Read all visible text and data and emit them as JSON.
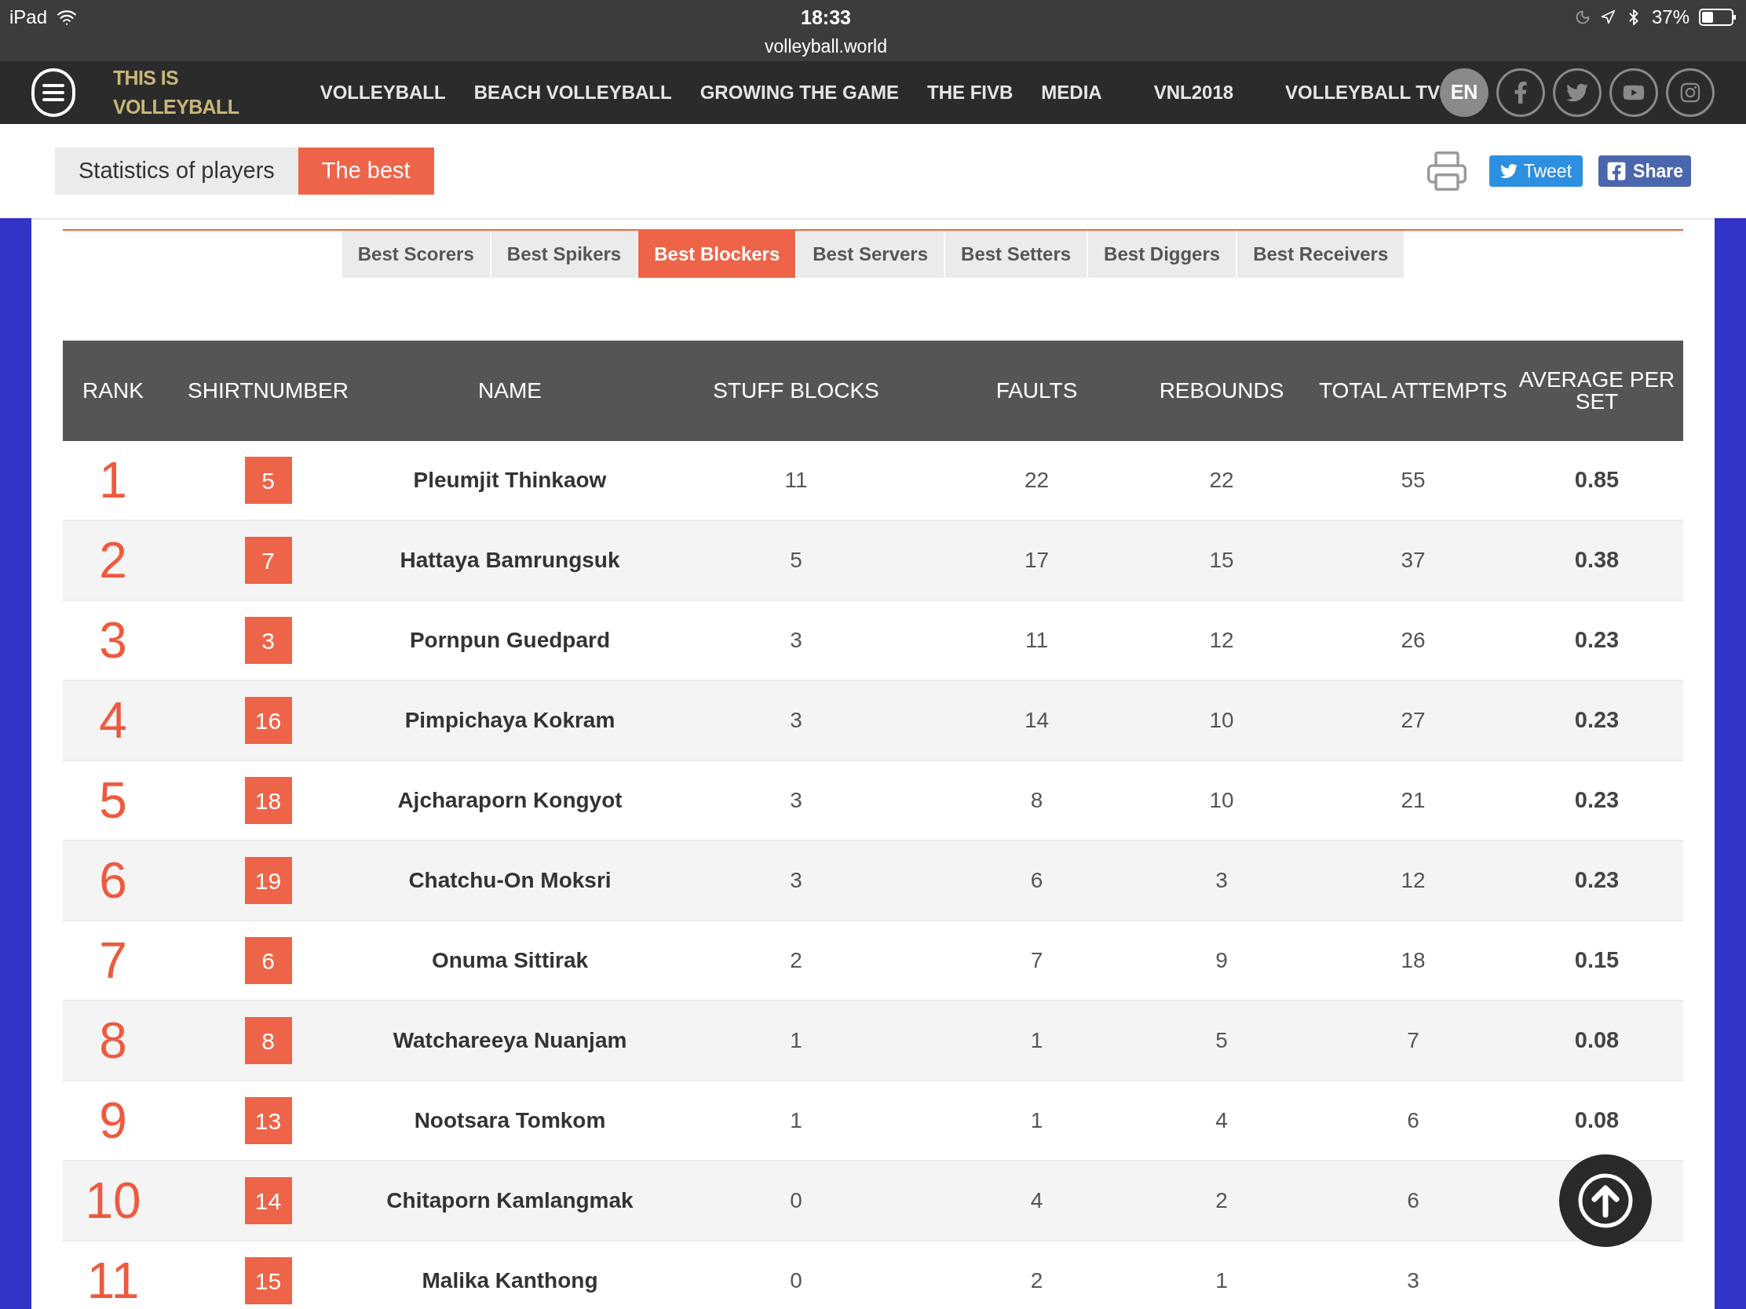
{
  "status_bar": {
    "device": "iPad",
    "time": "18:33",
    "url": "volleyball.world",
    "battery": "37%"
  },
  "nav": {
    "brand": "THIS IS VOLLEYBALL",
    "items": [
      {
        "label": "VOLLEYBALL"
      },
      {
        "label": "BEACH VOLLEYBALL"
      },
      {
        "label": "GROWING THE GAME"
      },
      {
        "label": "THE FIVB"
      },
      {
        "label": "MEDIA"
      },
      {
        "label": "VNL2018"
      },
      {
        "label": "VOLLEYBALL TV"
      }
    ],
    "language": "EN"
  },
  "breadcrumb": [
    {
      "label": "Statistics of players",
      "selected": false
    },
    {
      "label": "The best",
      "selected": true
    }
  ],
  "share": {
    "tweet": "Tweet",
    "share": "Share"
  },
  "tabs": [
    {
      "label": "Best Scorers",
      "selected": false
    },
    {
      "label": "Best Spikers",
      "selected": false
    },
    {
      "label": "Best Blockers",
      "selected": true
    },
    {
      "label": "Best Servers",
      "selected": false
    },
    {
      "label": "Best Setters",
      "selected": false
    },
    {
      "label": "Best Diggers",
      "selected": false
    },
    {
      "label": "Best Receivers",
      "selected": false
    }
  ],
  "table": {
    "columns": [
      "RANK",
      "SHIRTNUMBER",
      "NAME",
      "STUFF BLOCKS",
      "FAULTS",
      "REBOUNDS",
      "TOTAL ATTEMPTS",
      "AVERAGE PER SET"
    ],
    "rows": [
      {
        "rank": "1",
        "shirt": "5",
        "name": "Pleumjit Thinkaow",
        "stuff_blocks": "11",
        "faults": "22",
        "rebounds": "22",
        "total_attempts": "55",
        "average": "0.85"
      },
      {
        "rank": "2",
        "shirt": "7",
        "name": "Hattaya Bamrungsuk",
        "stuff_blocks": "5",
        "faults": "17",
        "rebounds": "15",
        "total_attempts": "37",
        "average": "0.38"
      },
      {
        "rank": "3",
        "shirt": "3",
        "name": "Pornpun Guedpard",
        "stuff_blocks": "3",
        "faults": "11",
        "rebounds": "12",
        "total_attempts": "26",
        "average": "0.23"
      },
      {
        "rank": "4",
        "shirt": "16",
        "name": "Pimpichaya Kokram",
        "stuff_blocks": "3",
        "faults": "14",
        "rebounds": "10",
        "total_attempts": "27",
        "average": "0.23"
      },
      {
        "rank": "5",
        "shirt": "18",
        "name": "Ajcharaporn Kongyot",
        "stuff_blocks": "3",
        "faults": "8",
        "rebounds": "10",
        "total_attempts": "21",
        "average": "0.23"
      },
      {
        "rank": "6",
        "shirt": "19",
        "name": "Chatchu-On Moksri",
        "stuff_blocks": "3",
        "faults": "6",
        "rebounds": "3",
        "total_attempts": "12",
        "average": "0.23"
      },
      {
        "rank": "7",
        "shirt": "6",
        "name": "Onuma Sittirak",
        "stuff_blocks": "2",
        "faults": "7",
        "rebounds": "9",
        "total_attempts": "18",
        "average": "0.15"
      },
      {
        "rank": "8",
        "shirt": "8",
        "name": "Watchareeya Nuanjam",
        "stuff_blocks": "1",
        "faults": "1",
        "rebounds": "5",
        "total_attempts": "7",
        "average": "0.08"
      },
      {
        "rank": "9",
        "shirt": "13",
        "name": "Nootsara Tomkom",
        "stuff_blocks": "1",
        "faults": "1",
        "rebounds": "4",
        "total_attempts": "6",
        "average": "0.08"
      },
      {
        "rank": "10",
        "shirt": "14",
        "name": "Chitaporn Kamlangmak",
        "stuff_blocks": "0",
        "faults": "4",
        "rebounds": "2",
        "total_attempts": "6"
      },
      {
        "rank": "11",
        "shirt": "15",
        "name": "Malika Kanthong",
        "stuff_blocks": "0",
        "faults": "2",
        "rebounds": "1",
        "total_attempts": "3"
      }
    ]
  }
}
